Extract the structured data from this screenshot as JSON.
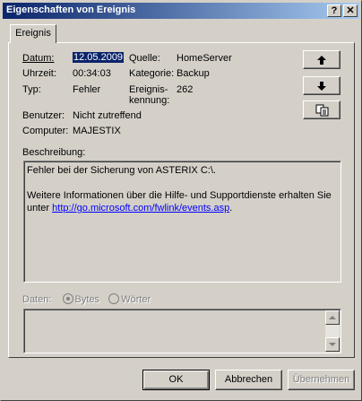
{
  "window": {
    "title": "Eigenschaften von Ereignis"
  },
  "titlebar_buttons": {
    "help": "?",
    "close": "✕"
  },
  "tab": {
    "label": "Ereignis"
  },
  "fields": {
    "datum_label": "Datum:",
    "datum_value": "12.05.2009",
    "quelle_label": "Quelle:",
    "quelle_value": "HomeServer",
    "uhrzeit_label": "Uhrzeit:",
    "uhrzeit_value": "00:34:03",
    "kategorie_label": "Kategorie:",
    "kategorie_value": "Backup",
    "typ_label": "Typ:",
    "typ_value": "Fehler",
    "kennung_label_1": "Ereignis-",
    "kennung_label_2": "kennung:",
    "kennung_value": "262",
    "benutzer_label": "Benutzer:",
    "benutzer_value": "Nicht zutreffend",
    "computer_label": "Computer:",
    "computer_value": "MAJESTIX"
  },
  "description": {
    "label": "Beschreibung:",
    "line1": "Fehler bei der Sicherung von ASTERIX C:\\.",
    "line2": "Weitere Informationen über die Hilfe- und Supportdienste erhalten Sie",
    "line3_prefix": "unter ",
    "link": "http://go.microsoft.com/fwlink/events.asp",
    "line3_suffix": "."
  },
  "data_section": {
    "label": "Daten:",
    "radio_bytes": "Bytes",
    "radio_words": "Wörter"
  },
  "side_buttons": {
    "up_icon": "arrow-up-icon",
    "down_icon": "arrow-down-icon",
    "copy_icon": "copy-icon"
  },
  "buttons": {
    "ok": "OK",
    "cancel": "Abbrechen",
    "apply": "Übernehmen"
  }
}
